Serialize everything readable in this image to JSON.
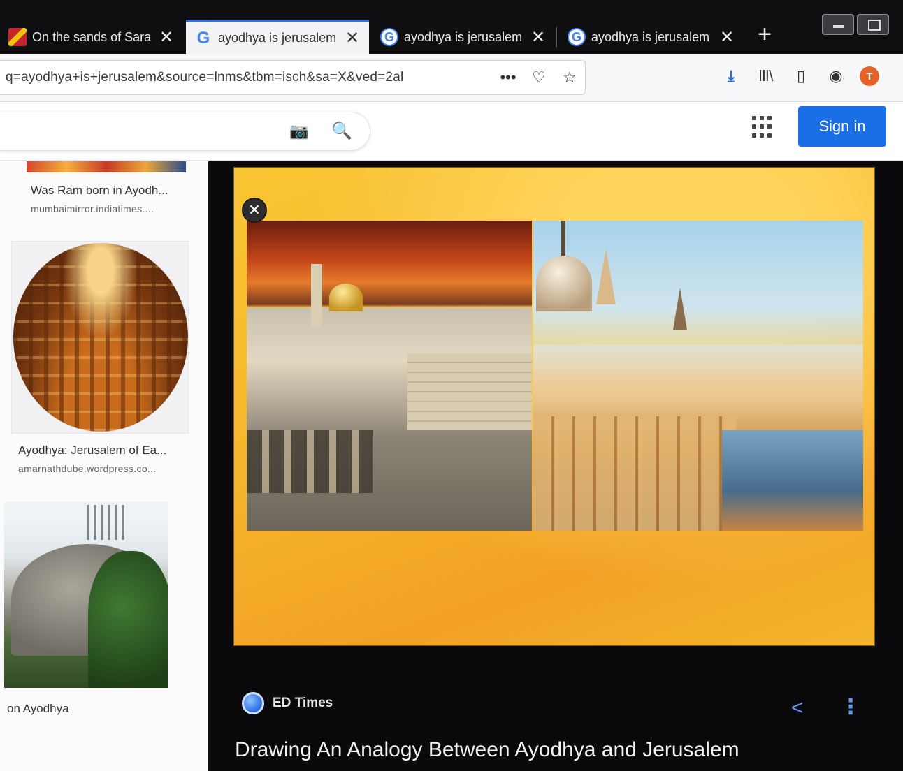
{
  "tabs": [
    {
      "title": "On the sands of Sara",
      "favicon": "flag-icon",
      "active": false
    },
    {
      "title": "ayodhya is jerusalem",
      "favicon": "google-icon",
      "active": true
    },
    {
      "title": "ayodhya is jerusalem",
      "favicon": "google-icon",
      "active": false
    },
    {
      "title": "ayodhya is jerusalem",
      "favicon": "google-icon",
      "active": false
    }
  ],
  "tab_close_glyph": "✕",
  "new_tab_glyph": "+",
  "google_glyph": "G",
  "url": "q=ayodhya+is+jerusalem&source=lnms&tbm=isch&sa=X&ved=2al",
  "url_actions": {
    "more": "•••",
    "pocket": "♡",
    "bookmark": "☆"
  },
  "toolbar": {
    "download": "⤓",
    "library": "lll\\",
    "sidebar": "▯",
    "account": "◉",
    "avatar_letter": "T"
  },
  "search": {
    "camera": "📷",
    "magnifier": "🔍"
  },
  "header": {
    "sign_in": "Sign in"
  },
  "left_results": [
    {
      "title": "Was Ram born in Ayodh...",
      "source": "mumbaimirror.indiatimes...."
    },
    {
      "title": "Ayodhya: Jerusalem of Ea...",
      "source": "amarnathdube.wordpress.co..."
    },
    {
      "title": "on Ayodhya",
      "source": ""
    }
  ],
  "preview": {
    "close_glyph": "✕",
    "source": "ED Times",
    "share_glyph": "<",
    "more_glyph": "⋮",
    "title": "Drawing An Analogy Between Ayodhya and Jerusalem"
  },
  "colors": {
    "accent": "#1a6fe8",
    "frame": "#f6b52a",
    "panel": "#0a0a0c"
  }
}
